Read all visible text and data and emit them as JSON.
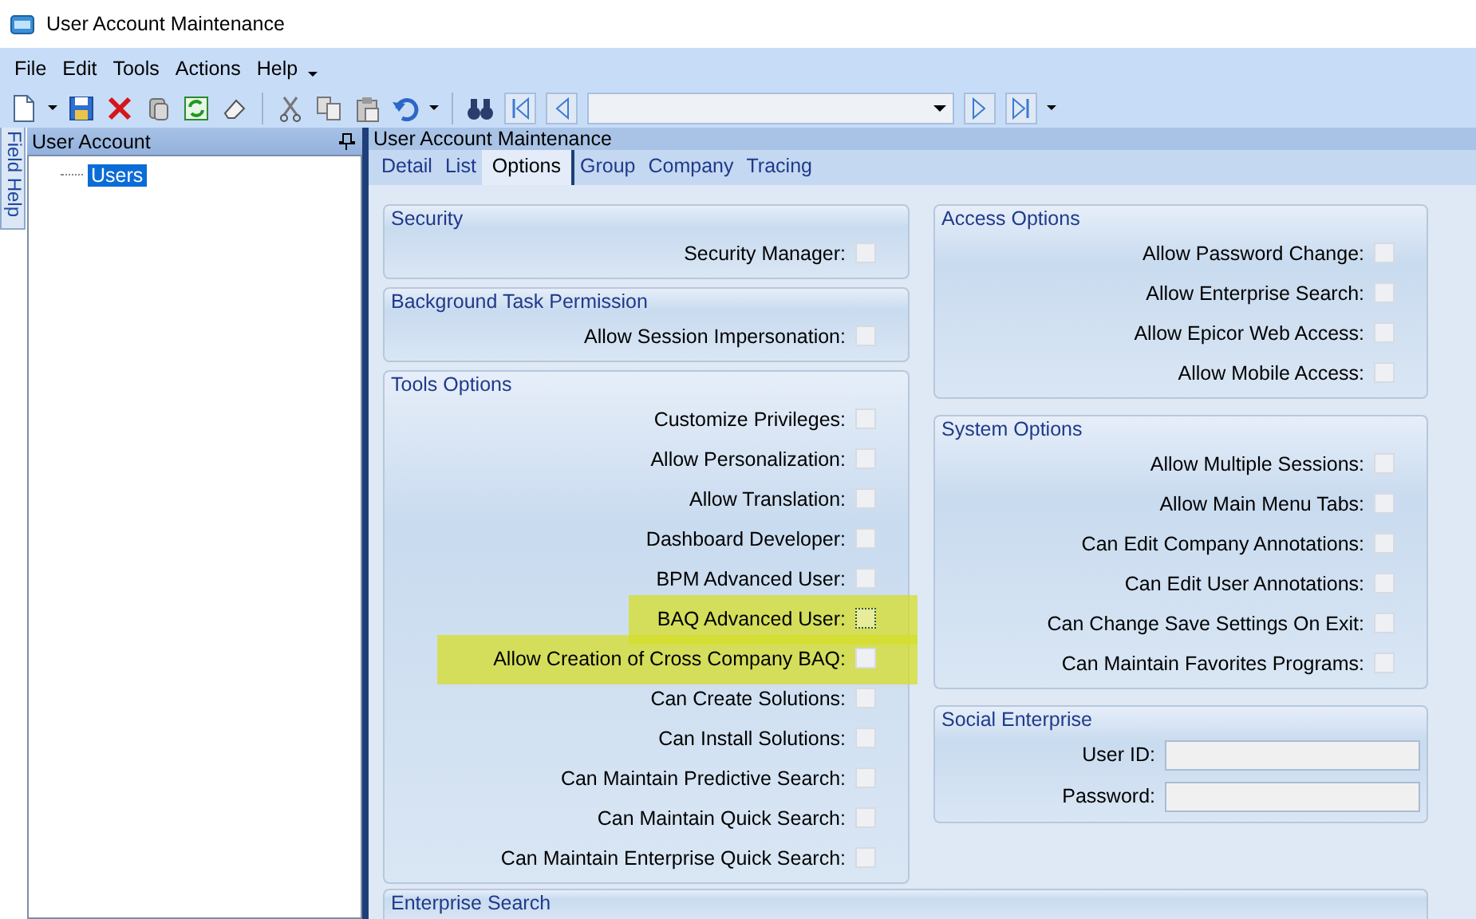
{
  "window": {
    "title": "User Account Maintenance"
  },
  "menu": [
    {
      "label": "File"
    },
    {
      "label": "Edit"
    },
    {
      "label": "Tools"
    },
    {
      "label": "Actions"
    },
    {
      "label": "Help"
    }
  ],
  "side_tab": {
    "label": "Field Help"
  },
  "tree_panel": {
    "title": "User Account",
    "items": [
      {
        "label": "Users",
        "selected": true
      }
    ]
  },
  "main_panel": {
    "title": "User Account Maintenance",
    "tabs": [
      {
        "label": "Detail",
        "selected": false
      },
      {
        "label": "List",
        "selected": false
      },
      {
        "label": "Options",
        "selected": true
      },
      {
        "label": "Group",
        "selected": false
      },
      {
        "label": "Company",
        "selected": false
      },
      {
        "label": "Tracing",
        "selected": false
      }
    ]
  },
  "left_groups": [
    {
      "title": "Security",
      "rows": [
        {
          "kind": "checkbox",
          "label": "Security Manager:",
          "checked": false,
          "highlighted": false,
          "focused": false
        }
      ]
    },
    {
      "title": "Background Task Permission",
      "rows": [
        {
          "kind": "checkbox",
          "label": "Allow Session Impersonation:",
          "checked": false,
          "highlighted": false,
          "focused": false
        }
      ]
    },
    {
      "title": "Tools Options",
      "rows": [
        {
          "kind": "checkbox",
          "label": "Customize Privileges:",
          "checked": false,
          "highlighted": false,
          "focused": false
        },
        {
          "kind": "checkbox",
          "label": "Allow Personalization:",
          "checked": false,
          "highlighted": false,
          "focused": false
        },
        {
          "kind": "checkbox",
          "label": "Allow Translation:",
          "checked": false,
          "highlighted": false,
          "focused": false
        },
        {
          "kind": "checkbox",
          "label": "Dashboard Developer:",
          "checked": false,
          "highlighted": false,
          "focused": false
        },
        {
          "kind": "checkbox",
          "label": "BPM Advanced User:",
          "checked": false,
          "highlighted": false,
          "focused": false
        },
        {
          "kind": "checkbox",
          "label": "BAQ Advanced User:",
          "checked": false,
          "highlighted": true,
          "focused": true
        },
        {
          "kind": "checkbox",
          "label": "Allow Creation of Cross Company BAQ:",
          "checked": false,
          "highlighted": true,
          "focused": false
        },
        {
          "kind": "checkbox",
          "label": "Can Create Solutions:",
          "checked": false,
          "highlighted": false,
          "focused": false
        },
        {
          "kind": "checkbox",
          "label": "Can Install Solutions:",
          "checked": false,
          "highlighted": false,
          "focused": false
        },
        {
          "kind": "checkbox",
          "label": "Can Maintain Predictive Search:",
          "checked": false,
          "highlighted": false,
          "focused": false
        },
        {
          "kind": "checkbox",
          "label": "Can Maintain Quick Search:",
          "checked": false,
          "highlighted": false,
          "focused": false
        },
        {
          "kind": "checkbox",
          "label": "Can Maintain Enterprise Quick Search:",
          "checked": false,
          "highlighted": false,
          "focused": false
        }
      ]
    }
  ],
  "right_groups": [
    {
      "title": "Access Options",
      "rows": [
        {
          "kind": "checkbox",
          "label": "Allow Password Change:",
          "checked": false,
          "highlighted": false,
          "focused": false
        },
        {
          "kind": "checkbox",
          "label": "Allow Enterprise Search:",
          "checked": false,
          "highlighted": false,
          "focused": false
        },
        {
          "kind": "checkbox",
          "label": "Allow Epicor Web Access:",
          "checked": false,
          "highlighted": false,
          "focused": false
        },
        {
          "kind": "checkbox",
          "label": "Allow Mobile Access:",
          "checked": false,
          "highlighted": false,
          "focused": false
        }
      ]
    },
    {
      "title": "System Options",
      "rows": [
        {
          "kind": "checkbox",
          "label": "Allow Multiple Sessions:",
          "checked": false,
          "highlighted": false,
          "focused": false
        },
        {
          "kind": "checkbox",
          "label": "Allow Main Menu Tabs:",
          "checked": false,
          "highlighted": false,
          "focused": false
        },
        {
          "kind": "checkbox",
          "label": "Can Edit Company Annotations:",
          "checked": false,
          "highlighted": false,
          "focused": false
        },
        {
          "kind": "checkbox",
          "label": "Can Edit User Annotations:",
          "checked": false,
          "highlighted": false,
          "focused": false
        },
        {
          "kind": "checkbox",
          "label": "Can Change Save Settings On Exit:",
          "checked": false,
          "highlighted": false,
          "focused": false
        },
        {
          "kind": "checkbox",
          "label": "Can Maintain Favorites Programs:",
          "checked": false,
          "highlighted": false,
          "focused": false
        }
      ]
    },
    {
      "title": "Social Enterprise",
      "rows": [
        {
          "kind": "field",
          "label": "User ID:"
        },
        {
          "kind": "field",
          "label": "Password:"
        }
      ]
    }
  ],
  "bottom_group": {
    "title": "Enterprise Search"
  }
}
